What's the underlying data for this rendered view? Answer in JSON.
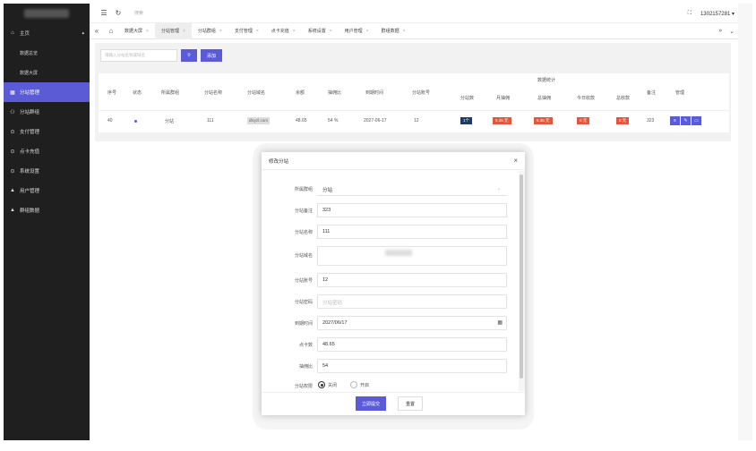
{
  "topbar": {
    "search_placeholder": "搜索",
    "user": "1302157281",
    "user_caret": "▾"
  },
  "sidebar": {
    "items": [
      {
        "label": "主页",
        "icon": "home-icon",
        "glyph": "⌂",
        "caret": "▴"
      },
      {
        "label": "数据总览",
        "sub": true
      },
      {
        "label": "数据大屏",
        "sub": true
      },
      {
        "label": "分站管理",
        "icon": "grid-icon",
        "glyph": "▦",
        "active": true
      },
      {
        "label": "分站群组",
        "icon": "group-icon",
        "glyph": "⚇"
      },
      {
        "label": "支付管理",
        "icon": "circle-check-icon",
        "glyph": "⊙"
      },
      {
        "label": "点卡充值",
        "icon": "circle-check-icon",
        "glyph": "⊙"
      },
      {
        "label": "系统设置",
        "icon": "circle-check-icon",
        "glyph": "⊙"
      },
      {
        "label": "用户管理",
        "icon": "user-icon",
        "glyph": "▲"
      },
      {
        "label": "群组数据",
        "icon": "users-icon",
        "glyph": "▲"
      }
    ]
  },
  "tabs": [
    {
      "label": "数据大屏"
    },
    {
      "label": "分站管理",
      "active": true
    },
    {
      "label": "分站群组"
    },
    {
      "label": "支付管理"
    },
    {
      "label": "点卡充值"
    },
    {
      "label": "系统设置"
    },
    {
      "label": "用户管理"
    },
    {
      "label": "群组数据"
    }
  ],
  "main": {
    "search_placeholder": "请输入分站名称或域名",
    "add_label": "添加",
    "group_header": "数据统计",
    "columns": [
      "序号",
      "状态",
      "所属群组",
      "分站名称",
      "分站域名",
      "余额",
      "抽佣比",
      "到期时间",
      "分站账号",
      "分站数",
      "月抽佣",
      "总抽佣",
      "今日收款",
      "总收款",
      "备注",
      "管理"
    ],
    "row": {
      "index": "40",
      "group": "分站",
      "name": "111",
      "domain": "dlxyzl.com",
      "balance": "48.65",
      "ratio": "54 %",
      "expire": "2027-06-17",
      "account": "12",
      "count": "1个",
      "month": "5.35 元",
      "total": "5.35 元",
      "today": "0 元",
      "income": "0 元",
      "remark": "323"
    }
  },
  "modal": {
    "title": "修改分站",
    "close": "×",
    "fields": [
      {
        "label": "所属群组",
        "value": "分站"
      },
      {
        "label": "分站备注",
        "value": "323"
      },
      {
        "label": "分站名称",
        "value": "111"
      },
      {
        "label": "分站域名",
        "value": ""
      },
      {
        "label": "分站账号",
        "value": "12"
      },
      {
        "label": "分站密码",
        "placeholder": "分站密码"
      },
      {
        "label": "到期时间",
        "value": "2027/06/17"
      },
      {
        "label": "点卡数",
        "value": "48.65"
      },
      {
        "label": "抽佣比",
        "value": "54"
      },
      {
        "label": "分站权限",
        "off": "关闭",
        "on": "开启"
      }
    ],
    "submit": "立即提交",
    "reset": "重置"
  }
}
